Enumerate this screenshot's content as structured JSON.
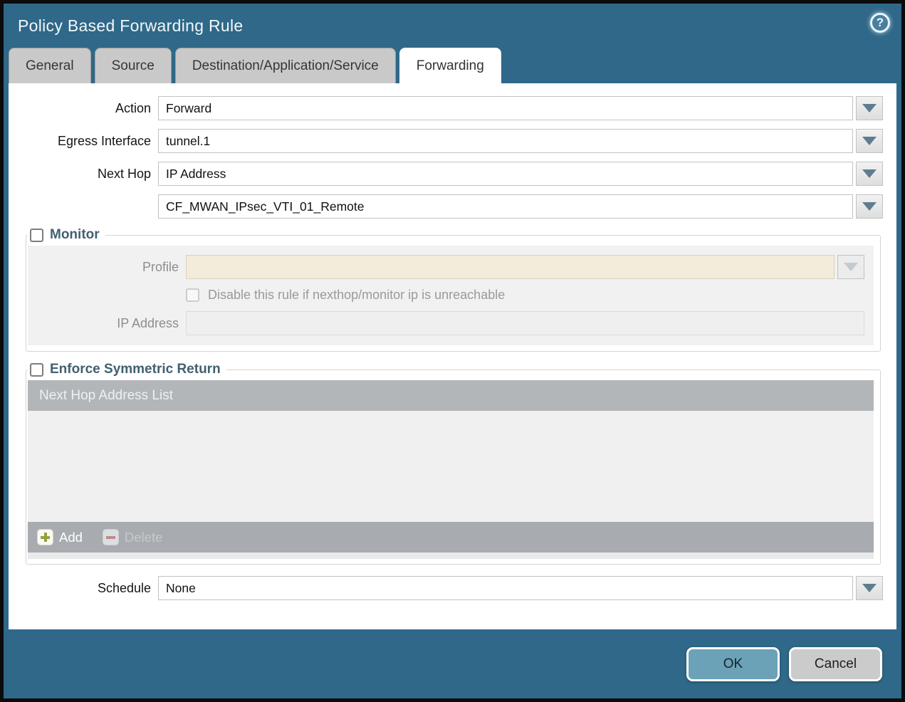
{
  "window": {
    "title": "Policy Based Forwarding Rule",
    "help_glyph": "?"
  },
  "tabs": [
    {
      "label": "General",
      "active": false
    },
    {
      "label": "Source",
      "active": false
    },
    {
      "label": "Destination/Application/Service",
      "active": false
    },
    {
      "label": "Forwarding",
      "active": true
    }
  ],
  "form": {
    "action": {
      "label": "Action",
      "value": "Forward"
    },
    "egress_interface": {
      "label": "Egress Interface",
      "value": "tunnel.1"
    },
    "next_hop": {
      "label": "Next Hop",
      "value": "IP Address"
    },
    "next_hop_address": {
      "value": "CF_MWAN_IPsec_VTI_01_Remote"
    },
    "schedule": {
      "label": "Schedule",
      "value": "None"
    }
  },
  "monitor": {
    "legend": "Monitor",
    "checked": false,
    "profile": {
      "label": "Profile",
      "value": ""
    },
    "disable_rule_checkbox": {
      "label": "Disable this rule if nexthop/monitor ip is unreachable",
      "checked": false
    },
    "ip_address": {
      "label": "IP Address",
      "value": ""
    }
  },
  "enforce_symmetric_return": {
    "legend": "Enforce Symmetric Return",
    "checked": false,
    "table": {
      "header": "Next Hop Address List",
      "rows": []
    },
    "add_label": "Add",
    "delete_label": "Delete",
    "delete_enabled": false
  },
  "footer": {
    "ok_label": "OK",
    "cancel_label": "Cancel"
  },
  "colors": {
    "titlebar_teal": "#2f6888",
    "active_tab_white": "#ffffff",
    "inactive_tab_gray": "#c9c9c9",
    "ok_button": "#6ba2b7",
    "cancel_button": "#cbcbcb",
    "profile_field_beige": "#f3ecdb",
    "add_icon_green": "#93a23f",
    "delete_icon_red": "#c08a8a",
    "table_header_gray": "#b2b6b9",
    "legend_text": "#41606f"
  }
}
